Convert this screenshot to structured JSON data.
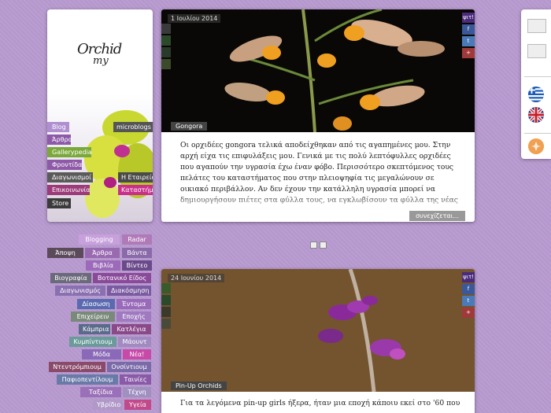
{
  "brand": {
    "logo_line1": "Orchid",
    "logo_line2": "my"
  },
  "nav": {
    "left": [
      {
        "label": "Blog",
        "color": "#b08fd0"
      },
      {
        "label": "Άρθρα",
        "color": "#8c5aa8"
      },
      {
        "label": "Gallerypedia",
        "color": "#7aa83a"
      },
      {
        "label": "Φροντίδα",
        "color": "#8e5aa8"
      },
      {
        "label": "Διαγωνισμοί",
        "color": "#5a5a5a"
      },
      {
        "label": "Επικοινωνία",
        "color": "#9c3a7a"
      },
      {
        "label": "Store",
        "color": "#3a3a3a"
      }
    ],
    "right": [
      {
        "label": "microblogs",
        "color": "#555555"
      },
      {
        "label": "Η Εταιρεία",
        "color": "#4a4a4a"
      },
      {
        "label": "Καταστήματα",
        "color": "#c8308a"
      }
    ]
  },
  "posts": [
    {
      "date": "1 Ιουλίου 2014",
      "share": "ψιτ!",
      "title": "Gongora",
      "body": "Οι ορχιδέες gongora τελικά αποδείχθηκαν από τις αγαπημένες μου. Στην αρχή είχα τις επιφυλάξεις μου. Γενικά με τις πολύ λεπτόφυλλες ορχιδέες που αγαπούν την υγρασία έχω έναν φόβο. Περισσότερο σκεπτόμενος τους πελάτες του καταστήματος που στην πλειοψηφία τις μεγαλώνουν σε οικιακό περιβάλλον. Αν δεν έχουν την κατάλληλη υγρασία μπορεί να δημιουργήσουν πιέτες στα φύλλα τους, να εγκλωβίσουν τα φύλλα της νέας ανάπτυξης και να τα χαλάσουν εσωτερικά επειδή δεν κατάφεραν να ξεδιπλωθούν εγκαίρως, να χάσουν την νέα",
      "more": "συνεχίζεται..."
    },
    {
      "date": "24 Ιουνίου 2014",
      "share": "ψιτ!",
      "title": "Pin-Up Orchids",
      "body": "Για τα λεγόμενα pin-up girls ήξερα, ήταν μια εποχή κάποιυ εκεί στο '60 που",
      "more": ""
    }
  ],
  "tags": [
    {
      "label": "Blogging",
      "color": "#c8a0dc"
    },
    {
      "label": "Radar",
      "color": "#b07ab8"
    },
    {
      "label": "Άποψη",
      "color": "#5a4a5a"
    },
    {
      "label": "Άρθρα",
      "color": "#9a6ab0"
    },
    {
      "label": "Βάντα",
      "color": "#8a6aa8"
    },
    {
      "label": "Βιβλία",
      "color": "#9c6ab8"
    },
    {
      "label": "Βίντεο",
      "color": "#6a4a8a"
    },
    {
      "label": "Βιογραφία",
      "color": "#6a6a7a"
    },
    {
      "label": "Βοτανικό Είδος",
      "color": "#8a4a9a"
    },
    {
      "label": "Διαγωνισμός",
      "color": "#8a70b0"
    },
    {
      "label": "Διακόσμηση",
      "color": "#7a5aa0"
    },
    {
      "label": "Δίασωση",
      "color": "#5a6ab0"
    },
    {
      "label": "Έντομα",
      "color": "#9a6aba"
    },
    {
      "label": "Επιχείρειν",
      "color": "#7a8a7a"
    },
    {
      "label": "Εποχής",
      "color": "#a07ac0"
    },
    {
      "label": "Κάμπρια",
      "color": "#5a6a8a"
    },
    {
      "label": "Κατλέγια",
      "color": "#8a4a8a"
    },
    {
      "label": "Κυμπίντιουμ",
      "color": "#6a9a9a"
    },
    {
      "label": "Μάουντ",
      "color": "#a08ac0"
    },
    {
      "label": "Μόδα",
      "color": "#8a6ab8"
    },
    {
      "label": "Νέα!",
      "color": "#c84aa8"
    },
    {
      "label": "Ντεντρόμπιουμ",
      "color": "#8a4a6a"
    },
    {
      "label": "Ονσίντιουμ",
      "color": "#7a6aa8"
    },
    {
      "label": "Παφιοπεντίλουμ",
      "color": "#6a7aa8"
    },
    {
      "label": "Ταινίες",
      "color": "#8a5aa8"
    },
    {
      "label": "Ταξίδια",
      "color": "#9a70b8"
    },
    {
      "label": "Τέχνη",
      "color": "#a090c0"
    },
    {
      "label": "Υβρίδιο",
      "color": "#b098c8"
    },
    {
      "label": "Υγεία",
      "color": "#c04a8a"
    }
  ],
  "share_colors": {
    "share": "#4a2a7a",
    "fb": "#3b5998",
    "tw": "#4a7ab8",
    "plus": "#a03a3a"
  }
}
